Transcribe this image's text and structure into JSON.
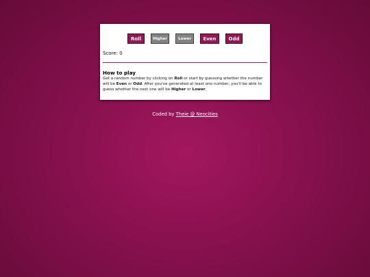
{
  "buttons": {
    "roll": "Roll",
    "higher": "Higher",
    "lower": "Lower",
    "even": "Even",
    "odd": "Odd"
  },
  "score": {
    "text": "Score: 0"
  },
  "howto": {
    "title": "How to play",
    "p1": "Get a random number by clicking on ",
    "roll": "Roll",
    "p2": " or start by guessing whether the number will be ",
    "even": "Even",
    "p3": " or ",
    "odd": "Odd",
    "p4": ". After you've generated at least one number, you'll be able to guess whether the next one will be ",
    "higher": "Higher",
    "p5": " or ",
    "lower": "Lower",
    "p6": "."
  },
  "footer": {
    "prefix": "Coded by ",
    "link": "Theie @ Neocities"
  },
  "colors": {
    "accent": "#9a1457",
    "disabled": "#848484",
    "background": "#8a1150"
  }
}
